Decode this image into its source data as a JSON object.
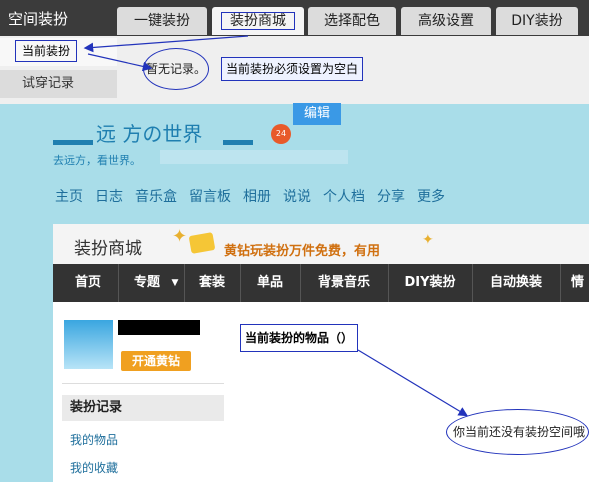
{
  "topbar": {
    "brand": "空间装扮",
    "tabs": [
      "一键装扮",
      "装扮商城",
      "选择配色",
      "高级设置",
      "DIY装扮"
    ]
  },
  "panel": {
    "current_label": "当前装扮",
    "no_record": "暂无记录。",
    "note": "当前装扮必须设置为空白",
    "tryon": "试穿记录"
  },
  "edit_label": "编辑",
  "space": {
    "title": "远 方の世界",
    "subtitle": "去远方，看世界。",
    "badge": "24"
  },
  "nav": [
    "主页",
    "日志",
    "音乐盒",
    "留言板",
    "相册",
    "说说",
    "个人档",
    "分享",
    "更多"
  ],
  "mall": {
    "title": "装扮商城",
    "promo": "黄钻玩装扮万件免费，有用",
    "nav": [
      "首页",
      "专题",
      "套装",
      "单品",
      "背景音乐",
      "DIY装扮",
      "自动换装",
      "情"
    ]
  },
  "profile": {
    "vip_button": "开通黄钻"
  },
  "sidebar": {
    "heading": "装扮记录",
    "links": [
      "我的物品",
      "我的收藏"
    ]
  },
  "main": {
    "items_label": "当前装扮的物品（）",
    "empty_message": "你当前还没有装扮空间哦"
  },
  "colors": {
    "annotation": "#2233bb",
    "accent": "#1f7fb0",
    "vip": "#f0a020"
  }
}
